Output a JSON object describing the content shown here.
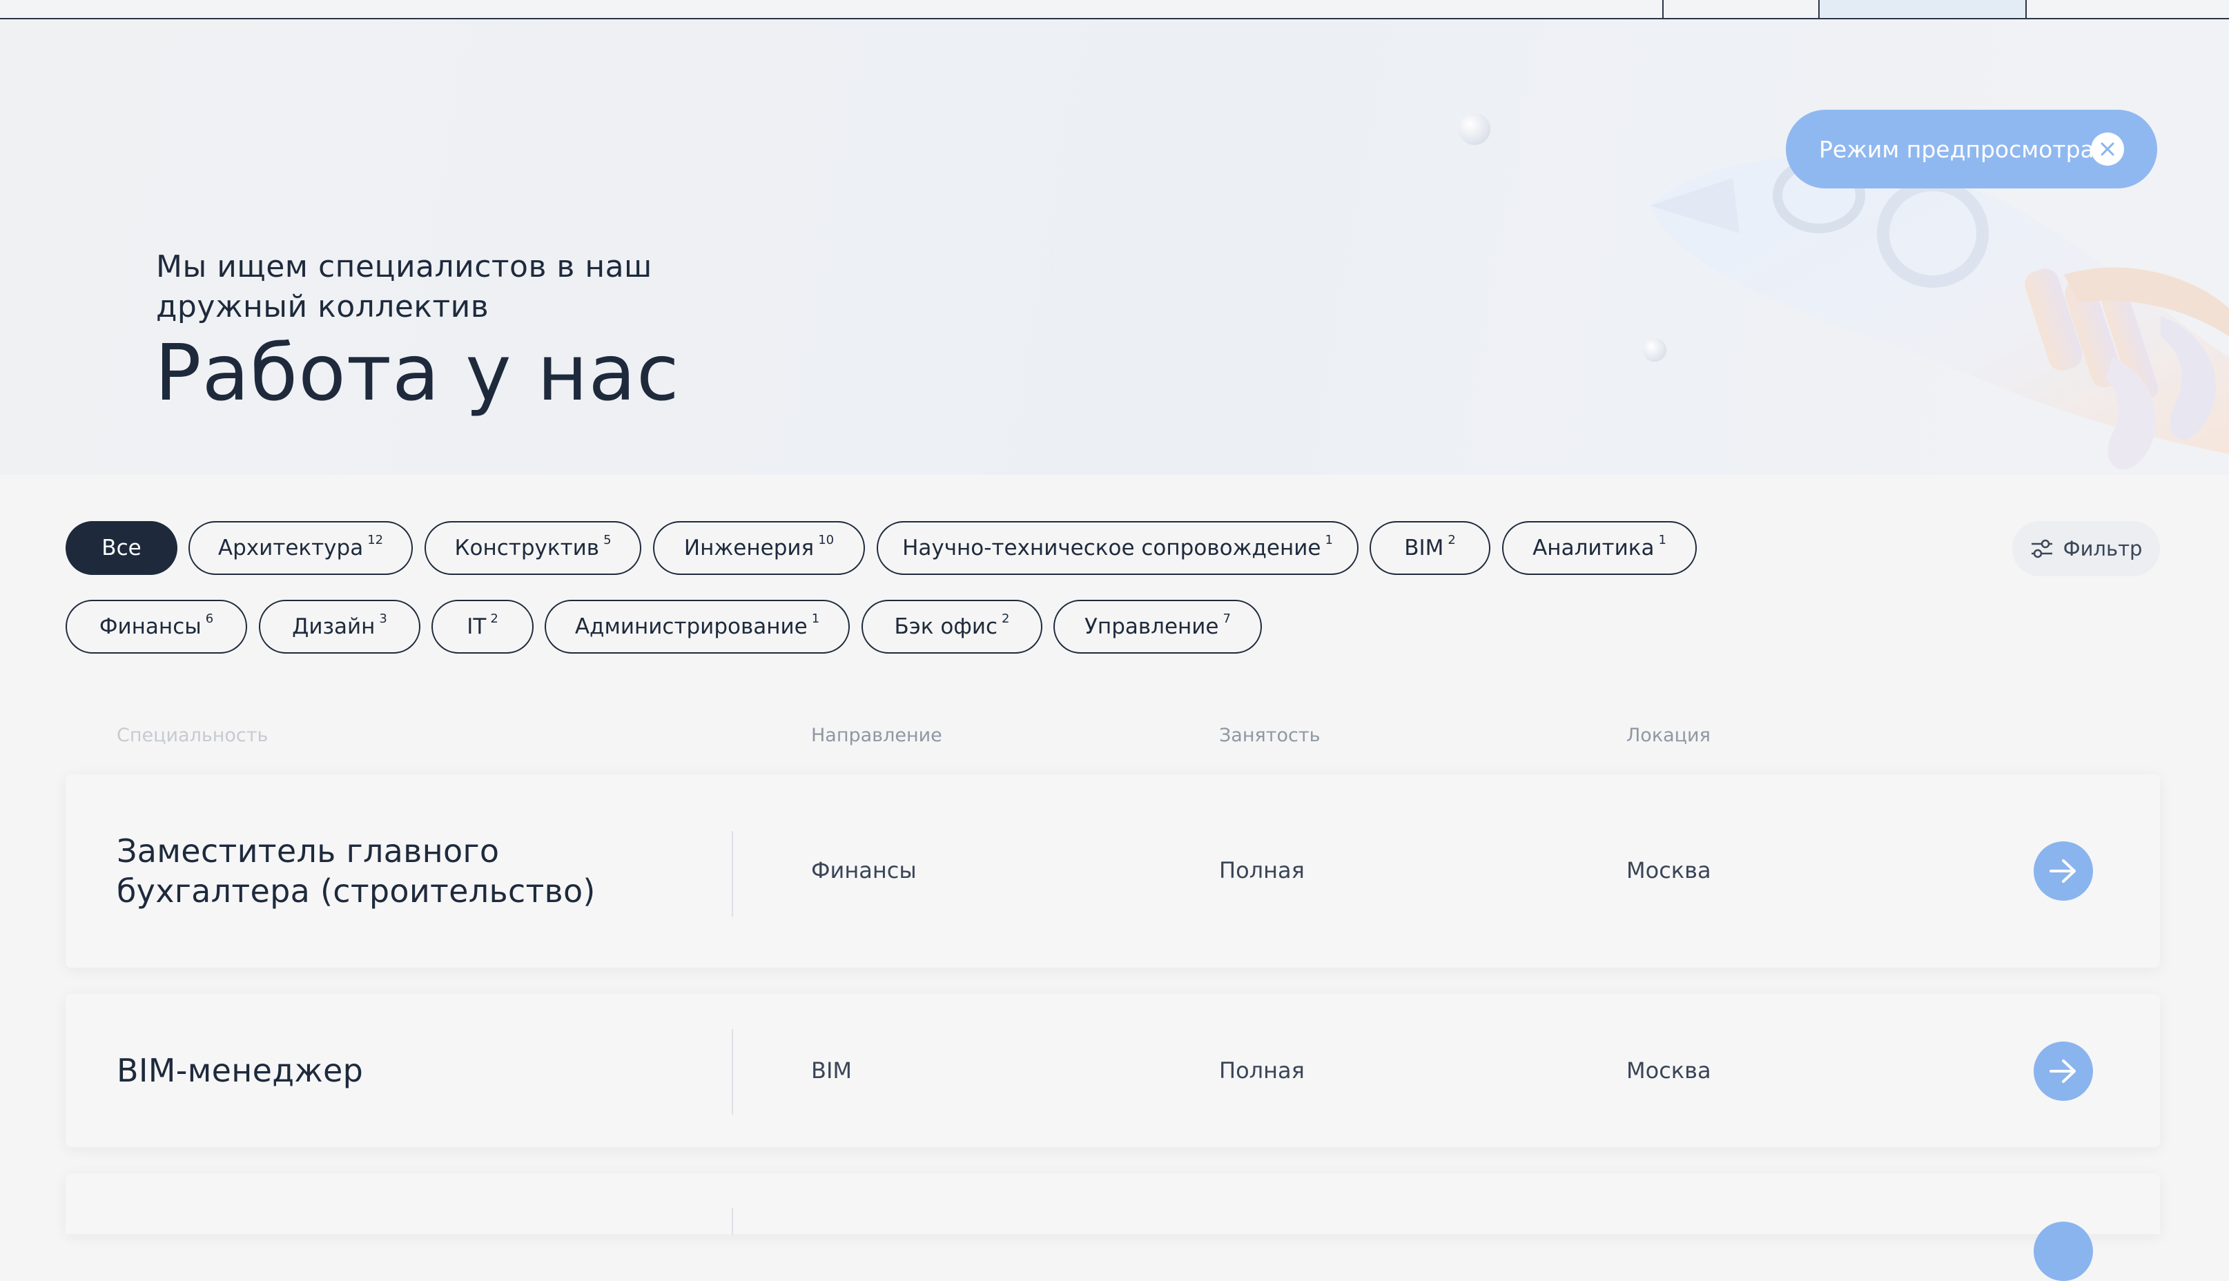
{
  "preview": {
    "label": "Режим предпросмотра"
  },
  "hero": {
    "subtitle": "Мы ищем специалистов в наш дружный коллектив",
    "title": "Работа у нас"
  },
  "filters": {
    "chips": [
      {
        "label": "Все",
        "count": ""
      },
      {
        "label": "Архитектура",
        "count": "12"
      },
      {
        "label": "Конструктив",
        "count": "5"
      },
      {
        "label": "Инженерия",
        "count": "10"
      },
      {
        "label": "Научно-техническое сопровождение",
        "count": "1"
      },
      {
        "label": "BIM",
        "count": "2"
      },
      {
        "label": "Аналитика",
        "count": "1"
      },
      {
        "label": "Финансы",
        "count": "6"
      },
      {
        "label": "Дизайн",
        "count": "3"
      },
      {
        "label": "IT",
        "count": "2"
      },
      {
        "label": "Администрирование",
        "count": "1"
      },
      {
        "label": "Бэк офис",
        "count": "2"
      },
      {
        "label": "Управление",
        "count": "7"
      }
    ],
    "filter_button": "Фильтр"
  },
  "table": {
    "headers": {
      "specialty": "Специальность",
      "direction": "Направление",
      "employment": "Занятость",
      "location": "Локация"
    },
    "rows": [
      {
        "specialty": "Заместитель главного бухгалтера (строительство)",
        "direction": "Финансы",
        "employment": "Полная",
        "location": "Москва"
      },
      {
        "specialty": "BIM-менеджер",
        "direction": "BIM",
        "employment": "Полная",
        "location": "Москва"
      }
    ]
  },
  "colors": {
    "accent": "#8ab4ee",
    "dark": "#1e2a3c",
    "preview_pill": "#90b8f0"
  }
}
